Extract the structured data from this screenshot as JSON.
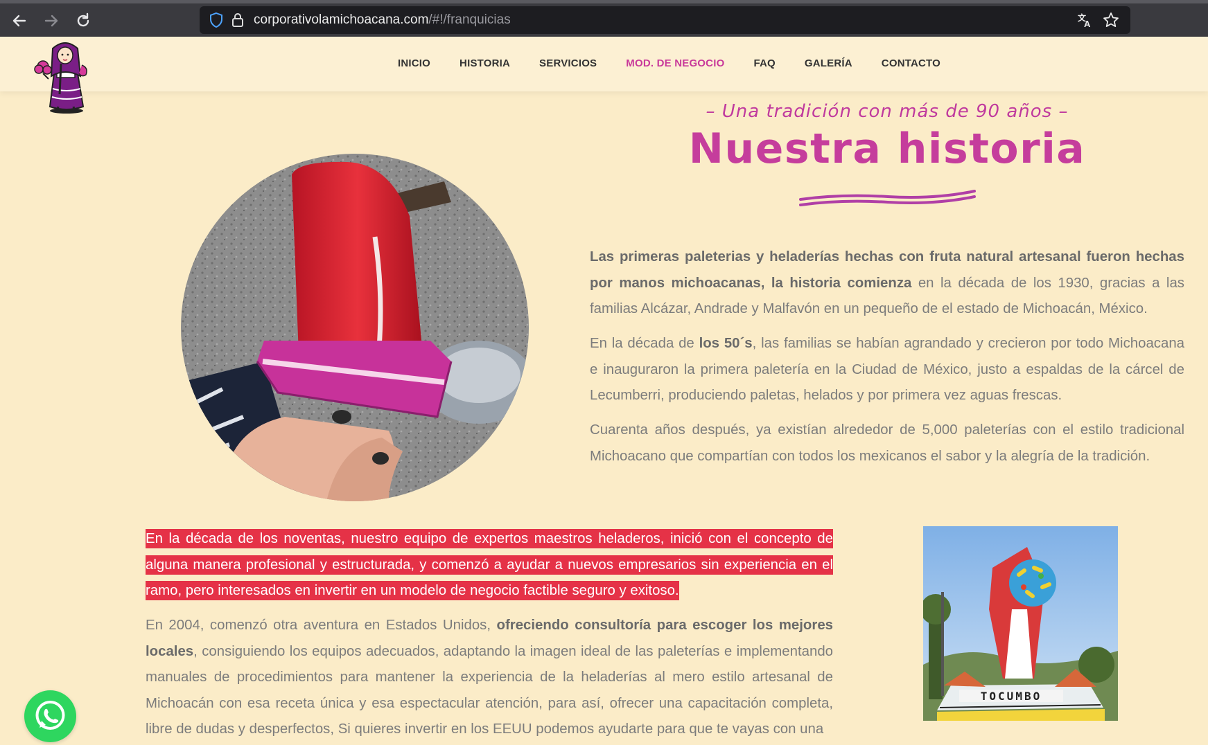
{
  "browser": {
    "url_host": "corporativolamichoacana.com",
    "url_path": "/#!/franquicias",
    "back_icon": "arrow-left",
    "forward_icon": "arrow-right",
    "reload_icon": "reload",
    "translate_icon": "translate"
  },
  "nav": {
    "items": [
      {
        "label": "INICIO",
        "active": false
      },
      {
        "label": "HISTORIA",
        "active": false
      },
      {
        "label": "SERVICIOS",
        "active": false
      },
      {
        "label": "MOD. DE NEGOCIO",
        "active": true
      },
      {
        "label": "FAQ",
        "active": false
      },
      {
        "label": "GALERÍA",
        "active": false
      },
      {
        "label": "CONTACTO",
        "active": false
      }
    ]
  },
  "hero": {
    "tagline": "– Una tradición con más de 90 años –",
    "title": "Nuestra historia"
  },
  "history": {
    "p1_bold": "Las primeras paleterias y heladerías hechas con fruta natural artesanal fueron hechas por manos michoacanas, la historia comienza",
    "p1_rest": " en la década de los 1930, gracias a las familias Alcázar, Andrade y Malfavón en un pequeño de el estado de Michoacán, México.",
    "p2_start": "En la década de ",
    "p2_bold": "los 50´s",
    "p2_rest": ", las familias se habían agrandado y crecieron por todo Michoacana e inauguraron la primera paletería en la Ciudad de México, justo a espaldas de la cárcel de Lecumberri, produciendo paletas, helados y por primera vez aguas frescas.",
    "p3": "Cuarenta años después, ya existían alrededor de 5,000 paleterías con el estilo tradicional Michoacano que compartían con todos los mexicanos el sabor y la alegría de la tradición.",
    "p4_highlight": "En la década de los noventas, nuestro equipo de expertos maestros heladeros, inició con el concepto de alguna manera profesional y estructurada, y comenzó a ayudar a nuevos empresarios sin experiencia en el ramo, pero interesados en invertir en un modelo de negocio factible seguro y exitoso.",
    "p5_start": "En 2004, comenzó otra aventura en Estados Unidos, ",
    "p5_bold": "ofreciendo consultoría para escoger los mejores locales",
    "p5_rest": ", consiguiendo los equipos adecuados, adaptando la imagen ideal de las paleterías e implementando manuales de procedimientos para mantener la experiencia de la heladerías al mero estilo artesanal de Michoacán  con esa receta única y esa espectacular atención, para así, ofrecer una capacitación completa, libre de dudas y desperfectos, Si quieres invertir en los EEUU podemos ayudarte para que te vayas con una"
  },
  "monument_sign": "TOCUMBO",
  "colors": {
    "background": "#fbecc8",
    "accent_pink": "#c53d9c",
    "highlight_red": "#e53247",
    "whatsapp_green": "#2ed65f"
  }
}
